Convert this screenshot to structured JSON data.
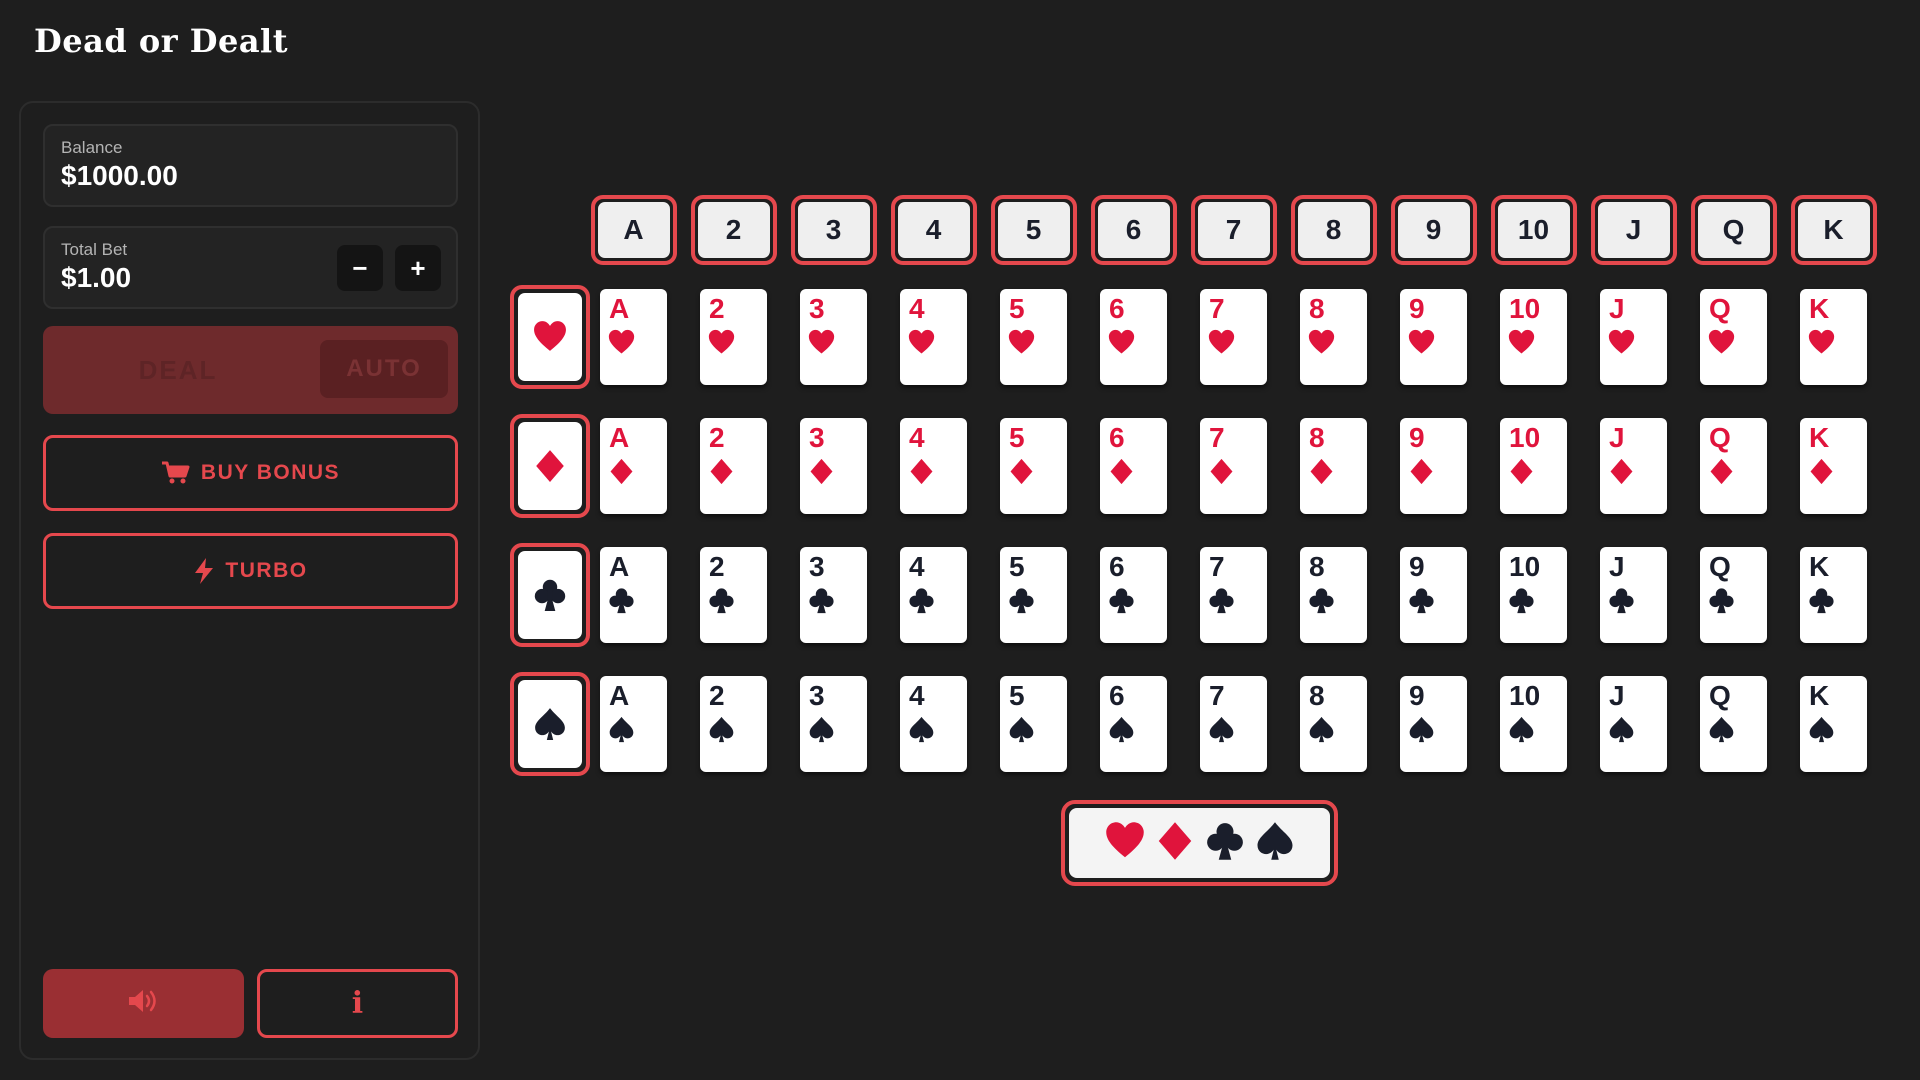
{
  "app": {
    "title": "Dead or Dealt"
  },
  "sidebar": {
    "balance": {
      "label": "Balance",
      "value": "$1000.00"
    },
    "total_bet": {
      "label": "Total Bet",
      "value": "$1.00",
      "decrease_label": "−",
      "increase_label": "+"
    },
    "deal_label": "DEAL",
    "auto_label": "AUTO",
    "buy_bonus_label": "BUY BONUS",
    "turbo_label": "TURBO",
    "sound_icon": "speaker-icon",
    "info_label": "i"
  },
  "board": {
    "ranks": [
      "A",
      "2",
      "3",
      "4",
      "5",
      "6",
      "7",
      "8",
      "9",
      "10",
      "J",
      "Q",
      "K"
    ],
    "suits": [
      {
        "name": "hearts",
        "color": "red"
      },
      {
        "name": "diamonds",
        "color": "red"
      },
      {
        "name": "clubs",
        "color": "black"
      },
      {
        "name": "spades",
        "color": "black"
      }
    ],
    "all_suits_button": [
      "hearts",
      "diamonds",
      "clubs",
      "spades"
    ]
  },
  "colors": {
    "background": "#1e1e1e",
    "accent": "#e5484d",
    "card_red": "#e0143c",
    "card_black": "#1a1e2b",
    "deal_disabled": "#6e2a2c",
    "sound_button": "#9a2f33"
  }
}
